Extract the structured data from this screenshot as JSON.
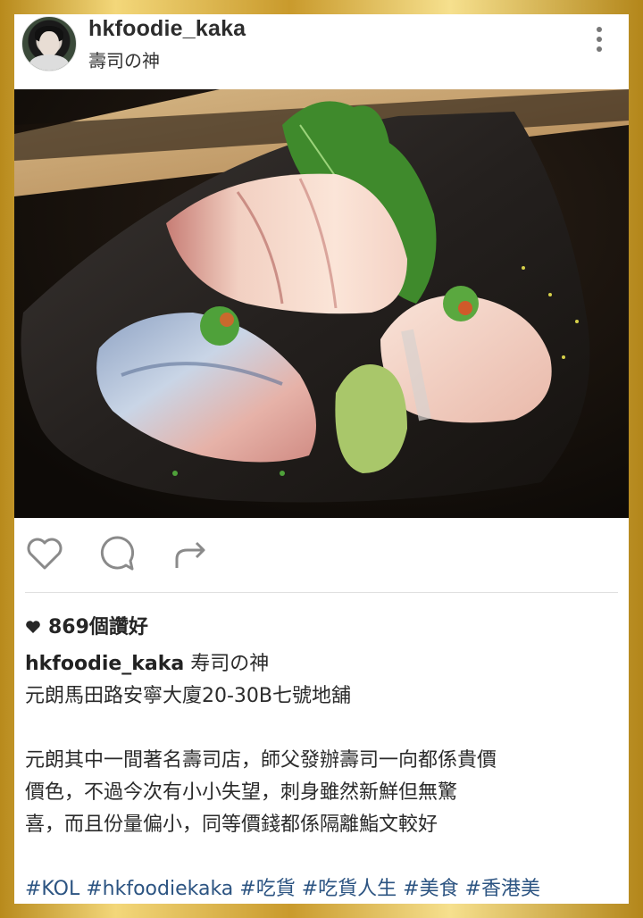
{
  "post": {
    "username": "hkfoodie_kaka",
    "location": "壽司の神",
    "more_icon": "more-vertical-icon",
    "likes_text": "869個讚好",
    "caption_user": "hkfoodie_kaka",
    "caption_title": " 寿司の神",
    "address": "元朗馬田路安寧大廈20-30B七號地舖",
    "body_lines": [
      "元朗其中一間著名壽司店，師父發辦壽司一向都係貴價",
      "價色，不過今次有小小失望，刺身雖然新鮮但無驚",
      "喜，而且份量偏小，同等價錢都係隔離鮨文較好"
    ],
    "hashtags": "#KOL #hkfoodiekaka #吃貨 #吃貨人生 #美食 #香港美"
  },
  "colors": {
    "frame_gold": "#d4a93a",
    "hashtag_blue": "#2c5482",
    "text_dark": "#262626"
  }
}
